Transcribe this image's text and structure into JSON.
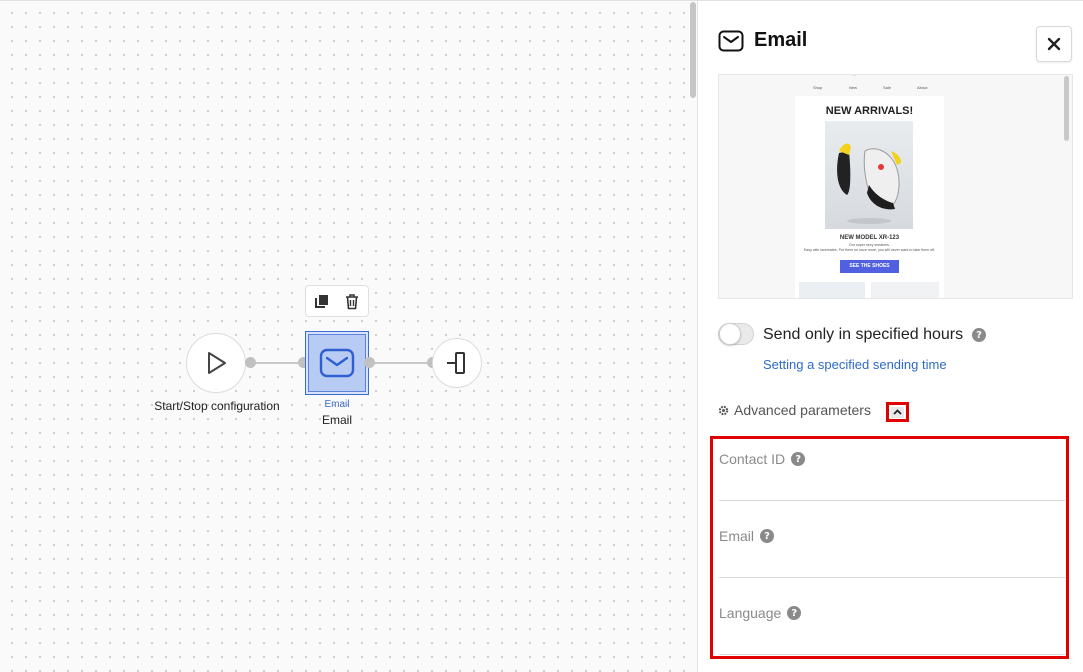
{
  "canvas": {
    "nodes": {
      "start": {
        "label": "Start/Stop configuration",
        "icon": "play-icon"
      },
      "email": {
        "type_label": "Email",
        "label": "Email",
        "icon": "envelope-icon"
      },
      "end": {
        "icon": "exit-icon"
      }
    },
    "toolbar": {
      "copy_icon": "copy-icon",
      "delete_icon": "trash-icon"
    }
  },
  "panel": {
    "title": "Email",
    "title_icon": "envelope-icon",
    "close_icon": "close-icon",
    "preview": {
      "logo": "logo",
      "nav": [
        "Shop",
        "New",
        "Sale",
        "About"
      ],
      "heading": "NEW ARRIVALS!",
      "model": "NEW MODEL XR-123",
      "line1": "Our super sexy sneakers.",
      "line2": "Easy with lacemates. Put them on once more, you will never want to take them off.",
      "button": "SEE THE SHOES"
    },
    "send_hours": {
      "label": "Send only in specified hours",
      "enabled": false
    },
    "send_hours_link": "Setting a specified sending time",
    "advanced": {
      "label": "Advanced parameters",
      "expanded": true
    },
    "params": [
      {
        "label": "Contact ID",
        "value": ""
      },
      {
        "label": "Email",
        "value": ""
      },
      {
        "label": "Language",
        "value": ""
      }
    ],
    "colors": {
      "highlight": "#e00000",
      "link": "#2d6ac9",
      "node_selected": "#b8cbf3"
    }
  }
}
